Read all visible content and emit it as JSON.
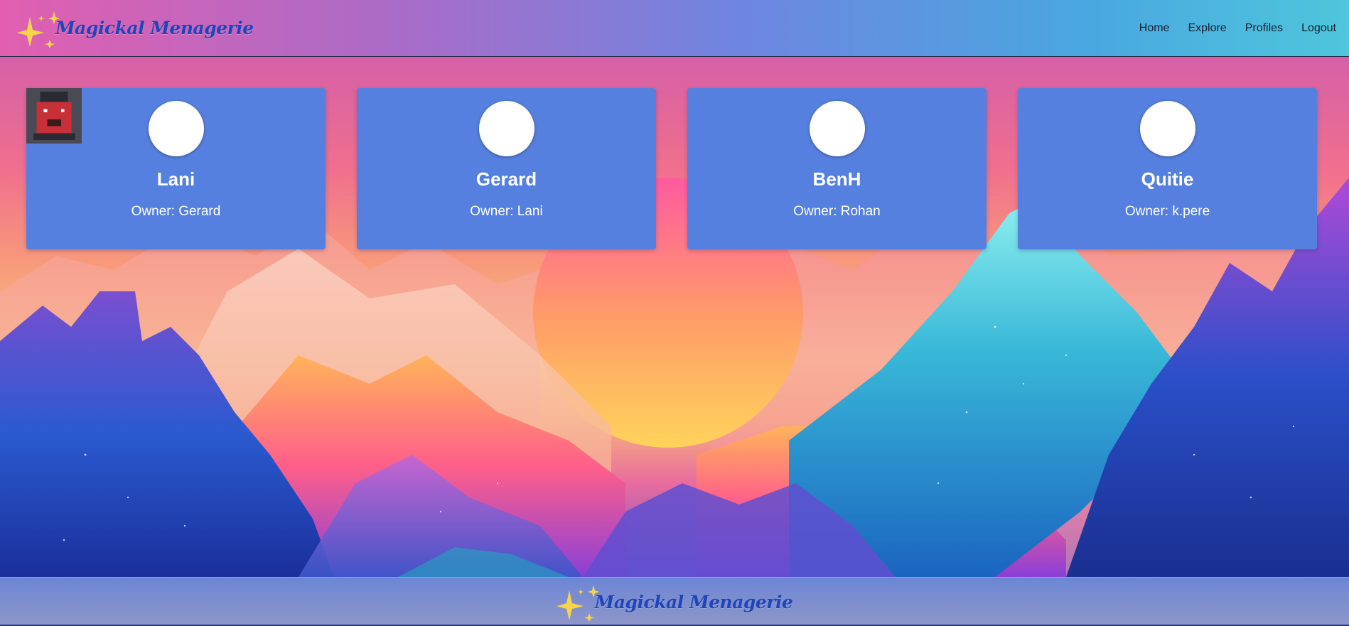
{
  "header": {
    "logo_text": "Magickal Menagerie",
    "nav": [
      {
        "label": "Home"
      },
      {
        "label": "Explore"
      },
      {
        "label": "Profiles"
      },
      {
        "label": "Logout"
      }
    ]
  },
  "cards": [
    {
      "name": "Lani",
      "owner": "Owner: Gerard",
      "avatar_icon": "purple-creature-avatar"
    },
    {
      "name": "Gerard",
      "owner": "Owner: Lani",
      "avatar_icon": "tan-creature-avatar"
    },
    {
      "name": "BenH",
      "owner": "Owner: Rohan",
      "avatar_icon": "red-yellow-creature-avatar"
    },
    {
      "name": "Quitie",
      "owner": "Owner: k.pere",
      "avatar_icon": "red-dark-creature-avatar"
    }
  ],
  "footer": {
    "logo_text": "Magickal Menagerie"
  },
  "colors": {
    "card_bg": "#5580e0",
    "logo_text": "#1f45b8",
    "sparkle": "#f7d44a"
  }
}
